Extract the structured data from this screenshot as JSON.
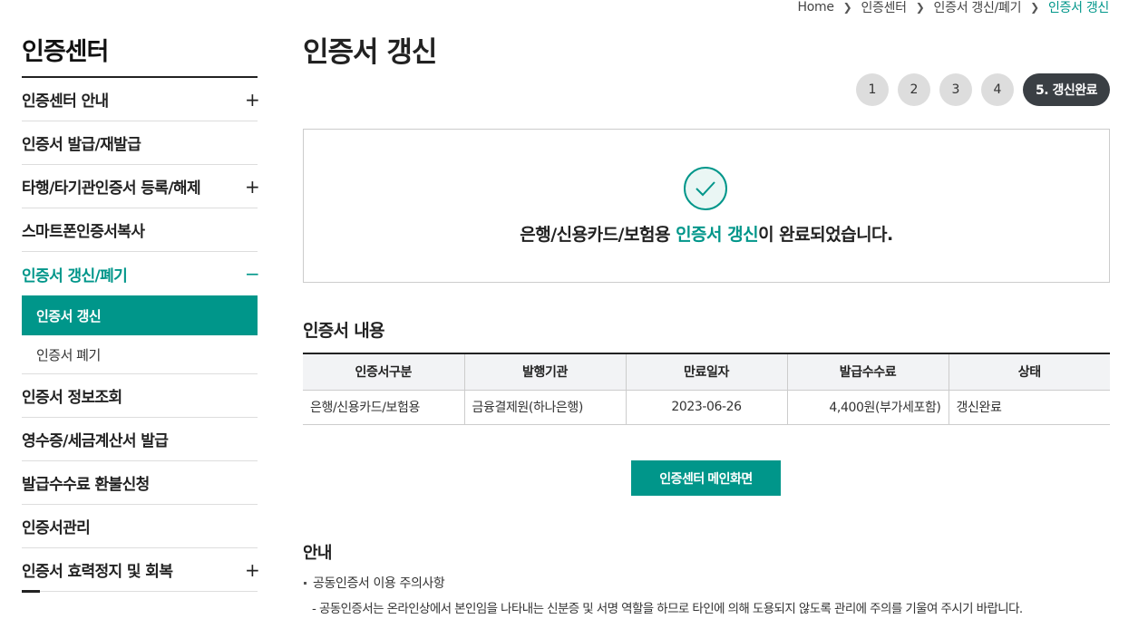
{
  "breadcrumb": {
    "items": [
      "Home",
      "인증센터",
      "인증서 갱신/폐기",
      "인증서 갱신"
    ]
  },
  "sidebar": {
    "title": "인증센터",
    "items": [
      {
        "label": "인증센터 안내",
        "toggle": "+"
      },
      {
        "label": "인증서 발급/재발급",
        "toggle": ""
      },
      {
        "label": "타행/타기관인증서 등록/해제",
        "toggle": "+"
      },
      {
        "label": "스마트폰인증서복사",
        "toggle": ""
      },
      {
        "label": "인증서 갱신/폐기",
        "toggle": "−"
      },
      {
        "label": "인증서 정보조회",
        "toggle": ""
      },
      {
        "label": "영수증/세금계산서 발급",
        "toggle": ""
      },
      {
        "label": "발급수수료 환불신청",
        "toggle": ""
      },
      {
        "label": "인증서관리",
        "toggle": ""
      },
      {
        "label": "인증서 효력정지 및 회복",
        "toggle": "+"
      }
    ],
    "sub_items": [
      {
        "label": "인증서 갱신"
      },
      {
        "label": "인증서 폐기"
      }
    ]
  },
  "main": {
    "title": "인증서 갱신",
    "steps": [
      "1",
      "2",
      "3",
      "4",
      "5. 갱신완료"
    ],
    "complete": {
      "icon": "check-circle-icon",
      "prefix": "은행/신용카드/보험용 ",
      "highlight": "인증서 갱신",
      "suffix": "이 완료되었습니다."
    },
    "content_title": "인증서 내용",
    "table": {
      "headers": [
        "인증서구분",
        "발행기관",
        "만료일자",
        "발급수수료",
        "상태"
      ],
      "row": [
        "은행/신용카드/보험용",
        "금융결제원(하나은행)",
        "2023-06-26",
        "4,400원(부가세포함)",
        "갱신완료"
      ]
    },
    "main_button": "인증센터 메인화면",
    "notice": {
      "title": "안내",
      "heading": "공동인증서 이용 주의사항",
      "body": "- 공동인증서는 온라인상에서 본인임을 나타내는 신분증 및 서명 역할을 하므로 타인에 의해 도용되지 않도록 관리에 주의를 기울여 주시기 바랍니다."
    }
  },
  "colors": {
    "accent": "#00968a",
    "dark": "#3a3f44"
  }
}
